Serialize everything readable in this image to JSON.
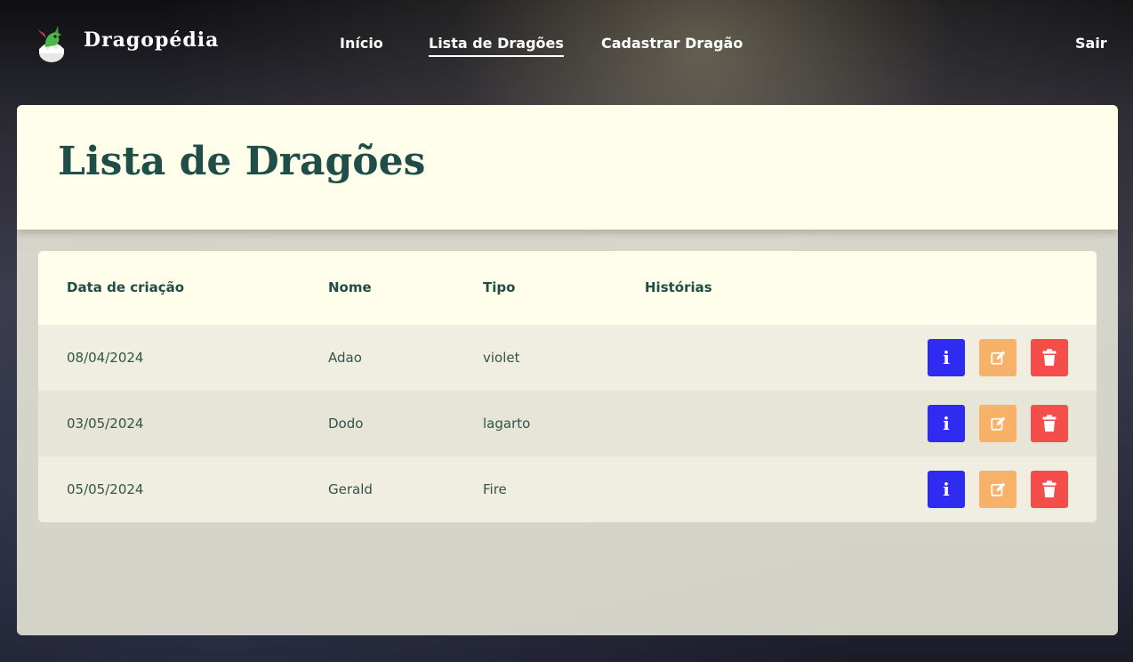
{
  "app": {
    "brand": "Dragopédia"
  },
  "nav": {
    "links": [
      {
        "label": "Início"
      },
      {
        "label": "Lista de Dragões",
        "active": true
      },
      {
        "label": "Cadastrar Dragão"
      }
    ],
    "logout_label": "Sair"
  },
  "page": {
    "title": "Lista de Dragões"
  },
  "table": {
    "headers": [
      "Data de criação",
      "Nome",
      "Tipo",
      "Histórias"
    ],
    "rows": [
      {
        "date": "08/04/2024",
        "name": "Adao",
        "type": "violet",
        "stories": ""
      },
      {
        "date": "03/05/2024",
        "name": "Dodo",
        "type": "lagarto",
        "stories": ""
      },
      {
        "date": "05/05/2024",
        "name": "Gerald",
        "type": "Fire",
        "stories": ""
      }
    ],
    "action_icons": {
      "info": "i",
      "edit": "edit-icon",
      "delete": "trash-icon"
    }
  },
  "colors": {
    "accent_text": "#1f4d47",
    "info_button": "#2f2bf0",
    "edit_button": "#f8b267",
    "delete_button": "#f44d4a",
    "panel_header": "#fefeea"
  }
}
